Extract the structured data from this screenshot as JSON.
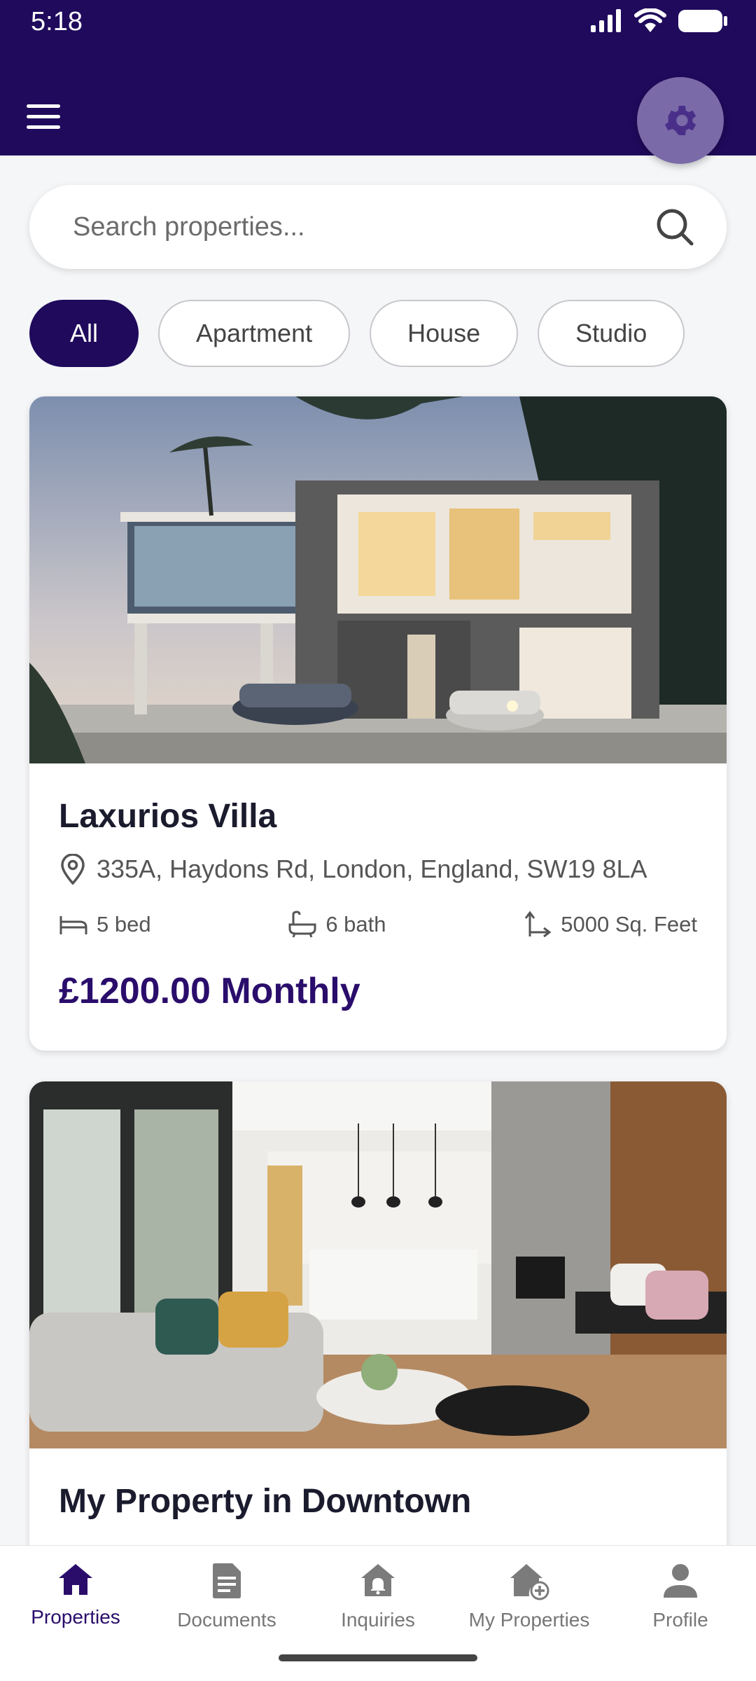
{
  "status_bar": {
    "time": "5:18"
  },
  "search": {
    "placeholder": "Search properties..."
  },
  "filters": {
    "all": "All",
    "apartment": "Apartment",
    "house": "House",
    "studio": "Studio"
  },
  "listings": [
    {
      "title": "Laxurios Villa",
      "address": "335A, Haydons Rd, London, England, SW19 8LA",
      "beds": "5 bed",
      "baths": "6 bath",
      "area": "5000 Sq. Feet",
      "price": "£1200.00 Monthly"
    },
    {
      "title": "My Property in Downtown"
    }
  ],
  "nav": {
    "properties": "Properties",
    "documents": "Documents",
    "inquiries": "Inquiries",
    "my_properties": "My Properties",
    "profile": "Profile"
  },
  "colors": {
    "primary": "#1f0a5c",
    "accent_text": "#2a0d6b",
    "background": "#f5f6f8"
  }
}
